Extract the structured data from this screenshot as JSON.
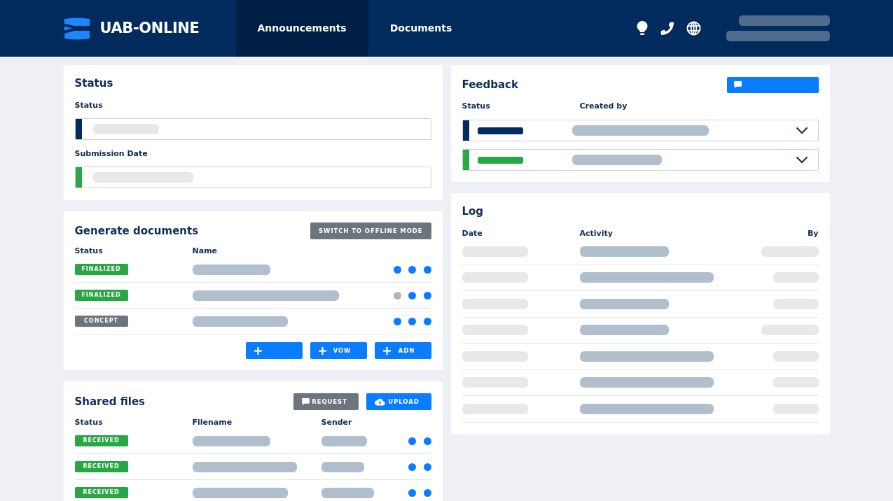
{
  "navbar": {
    "brand": "UAB-ONLINE",
    "tabs": [
      {
        "label": "Announcements",
        "selected": true
      },
      {
        "label": "Documents",
        "selected": false
      }
    ]
  },
  "status_card": {
    "title": "Status",
    "fields": [
      {
        "label": "Status",
        "color": "#002c5f"
      },
      {
        "label": "Submission Date",
        "color": "#28a745"
      }
    ]
  },
  "generate_documents": {
    "title": "Generate documents",
    "offline_button": "SWITCH TO OFFLINE MODE",
    "columns": [
      "Status",
      "Name"
    ],
    "rows": [
      {
        "status": "FINALIZED",
        "color": "#28a745",
        "actions": [
          {
            "disabled": false
          },
          {
            "disabled": false
          },
          {
            "disabled": false
          }
        ]
      },
      {
        "status": "FINALIZED",
        "color": "#28a745",
        "actions": [
          {
            "disabled": true
          },
          {
            "disabled": false
          },
          {
            "disabled": false
          }
        ]
      },
      {
        "status": "CONCEPT",
        "color": "#6c757d",
        "actions": [
          {
            "disabled": false
          },
          {
            "disabled": false
          },
          {
            "disabled": false
          }
        ]
      }
    ],
    "add_buttons": [
      {
        "kind": "add"
      },
      {
        "kind": "add",
        "label": "VOW"
      },
      {
        "kind": "add",
        "label": "ADN"
      }
    ]
  },
  "shared_files": {
    "title": "Shared files",
    "buttons": [
      {
        "kind": "request",
        "label": "REQUEST"
      },
      {
        "kind": "upload",
        "label": "UPLOAD"
      }
    ],
    "columns": [
      "Status",
      "Filename",
      "Sender"
    ],
    "rows": [
      {
        "status": "RECEIVED",
        "color": "#28a745",
        "actions": [
          {
            "disabled": false
          },
          {
            "disabled": false
          }
        ]
      },
      {
        "status": "RECEIVED",
        "color": "#28a745",
        "actions": [
          {
            "disabled": false
          },
          {
            "disabled": false
          }
        ]
      },
      {
        "status": "RECEIVED",
        "color": "#28a745",
        "actions": [
          {
            "disabled": false
          },
          {
            "disabled": false
          }
        ]
      }
    ]
  },
  "feedback": {
    "title": "Feedback",
    "columns": [
      "Status",
      "Created by"
    ],
    "rows": [
      {
        "color": "#002c5f",
        "expanded": false
      },
      {
        "color": "#28a745",
        "expanded": false
      }
    ]
  },
  "log": {
    "title": "Log",
    "columns": [
      "Date",
      "Activity",
      "By"
    ]
  }
}
